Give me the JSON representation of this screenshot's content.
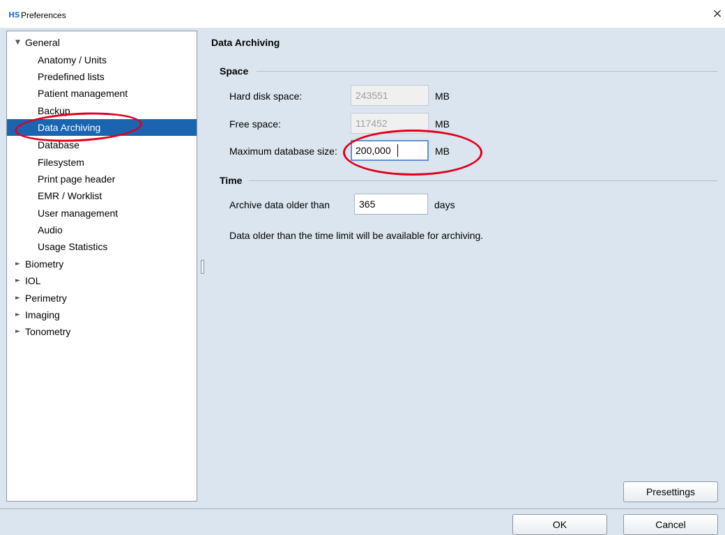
{
  "window": {
    "logo": "HS",
    "title": "Preferences",
    "close_glyph": "×"
  },
  "tree": {
    "items": [
      {
        "label": "General",
        "arrow": "▼"
      },
      {
        "label": "Anatomy / Units"
      },
      {
        "label": "Predefined lists"
      },
      {
        "label": "Patient management"
      },
      {
        "label": "Backup"
      },
      {
        "label": "Data Archiving",
        "selected": true
      },
      {
        "label": "Database"
      },
      {
        "label": "Filesystem"
      },
      {
        "label": "Print page header"
      },
      {
        "label": "EMR / Worklist"
      },
      {
        "label": "User management"
      },
      {
        "label": "Audio"
      },
      {
        "label": "Usage Statistics"
      },
      {
        "label": "Biometry",
        "arrow": "►"
      },
      {
        "label": "IOL",
        "arrow": "►"
      },
      {
        "label": "Perimetry",
        "arrow": "►"
      },
      {
        "label": "Imaging",
        "arrow": "►"
      },
      {
        "label": "Tonometry",
        "arrow": "►"
      }
    ]
  },
  "panel": {
    "title": "Data Archiving",
    "space": {
      "header": "Space",
      "hard_disk_label": "Hard disk space:",
      "hard_disk_value": "243551",
      "free_label": "Free space:",
      "free_value": "117452",
      "max_db_label": "Maximum database size:",
      "max_db_value": "200,000",
      "unit": "MB"
    },
    "time": {
      "header": "Time",
      "archive_label": "Archive data older than",
      "archive_value": "365",
      "unit": "days",
      "note": "Data older than the time limit will be available for archiving."
    }
  },
  "buttons": {
    "presettings": "Presettings",
    "ok": "OK",
    "cancel": "Cancel"
  },
  "colors": {
    "selection": "#1a64b0",
    "background": "#dbe5ef",
    "annotation": "#e0001a"
  }
}
